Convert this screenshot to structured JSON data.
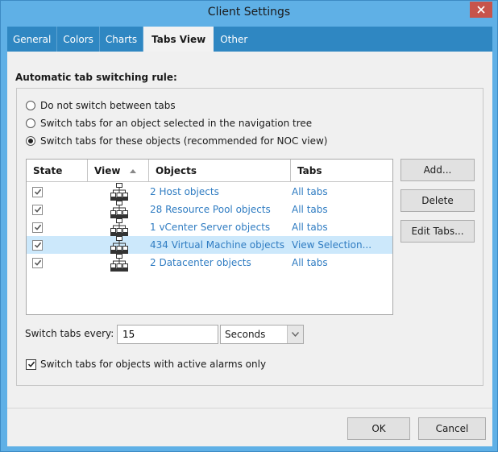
{
  "window": {
    "title": "Client Settings"
  },
  "tabs": [
    {
      "label": "General"
    },
    {
      "label": "Colors"
    },
    {
      "label": "Charts"
    },
    {
      "label": "Tabs View"
    },
    {
      "label": "Other"
    }
  ],
  "heading": "Automatic tab switching rule:",
  "radios": [
    {
      "label": "Do not switch between tabs",
      "checked": false
    },
    {
      "label": "Switch tabs for an object selected in the navigation tree",
      "checked": false
    },
    {
      "label": "Switch tabs for these objects (recommended for NOC view)",
      "checked": true
    }
  ],
  "table": {
    "headers": {
      "state": "State",
      "view": "View",
      "objects": "Objects",
      "tabs": "Tabs"
    },
    "rows": [
      {
        "checked": true,
        "objects": "2 Host objects",
        "tabs": "All tabs",
        "selected": false
      },
      {
        "checked": true,
        "objects": "28 Resource Pool objects",
        "tabs": "All tabs",
        "selected": false
      },
      {
        "checked": true,
        "objects": "1 vCenter Server objects",
        "tabs": "All tabs",
        "selected": false
      },
      {
        "checked": true,
        "objects": "434 Virtual Machine objects",
        "tabs": "View Selection...",
        "selected": true
      },
      {
        "checked": true,
        "objects": "2 Datacenter objects",
        "tabs": "All tabs",
        "selected": false
      }
    ]
  },
  "side_buttons": {
    "add": "Add...",
    "delete": "Delete",
    "edit_tabs": "Edit Tabs..."
  },
  "interval": {
    "label": "Switch tabs every:",
    "value": "15",
    "unit": "Seconds"
  },
  "alarms_only": {
    "label": "Switch tabs for objects with active alarms only",
    "checked": true
  },
  "footer": {
    "ok": "OK",
    "cancel": "Cancel"
  },
  "icons": {
    "close": "close-icon",
    "view": "network-tree-icon",
    "check": "checkmark-icon",
    "dropdown": "chevron-down-icon"
  },
  "colors": {
    "titlebar": "#5fb0e6",
    "tabstrip": "#2f87c2",
    "link": "#2f7cc2",
    "selection": "#cce8fb",
    "close": "#c7544b"
  }
}
